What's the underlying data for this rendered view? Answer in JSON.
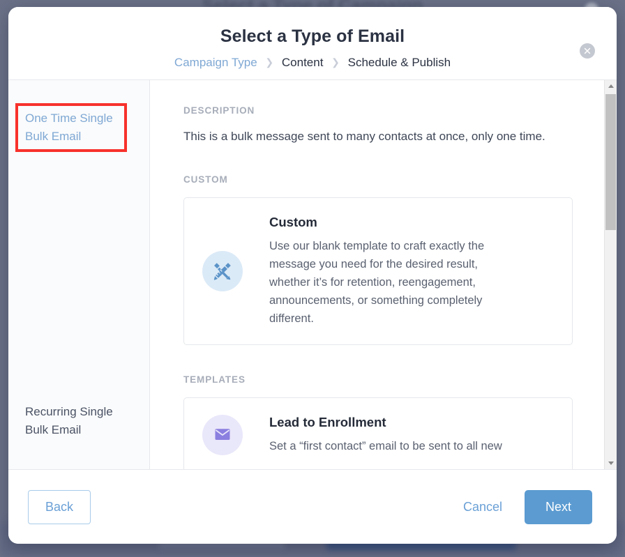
{
  "backdrop": {
    "blurred_title": "Select a Type of Campaign"
  },
  "modal": {
    "title": "Select a Type of Email",
    "close_icon": "close-icon",
    "breadcrumb": {
      "separator": "❯",
      "items": [
        {
          "label": "Campaign Type",
          "state": "link"
        },
        {
          "label": "Content",
          "state": "current"
        },
        {
          "label": "Schedule & Publish",
          "state": "current"
        }
      ]
    },
    "sidebar": {
      "items": [
        {
          "label": "One Time Single Bulk Email",
          "selected": true
        },
        {
          "label": "Recurring Single Bulk Email",
          "selected": false
        }
      ]
    },
    "content": {
      "description_label": "DESCRIPTION",
      "description_text": "This is a bulk message sent to many contacts at once, only one time.",
      "custom_label": "CUSTOM",
      "custom_card": {
        "title": "Custom",
        "text": "Use our blank template to craft exactly the message you need for the desired result, whether it’s for retention, reengagement, announcements, or something completely different.",
        "icon": "ruler-pencil-icon"
      },
      "templates_label": "TEMPLATES",
      "template_cards": [
        {
          "title": "Lead to Enrollment",
          "text": "Set a “first contact” email to be sent to all new",
          "icon": "template-icon"
        }
      ]
    },
    "scrollbar": {
      "up_arrow_icon": "caret-up-icon",
      "down_arrow_icon": "caret-down-icon"
    },
    "footer": {
      "back_label": "Back",
      "cancel_label": "Cancel",
      "next_label": "Next"
    }
  },
  "annotation": {
    "highlight_color": "#f8312c",
    "target": "One Time Single Bulk Email"
  },
  "colors": {
    "accent_blue": "#5b9bd1",
    "link_blue": "#7fa8d4",
    "text_dark": "#2b3242",
    "muted_label": "#a7adb9",
    "backdrop": "#6a7189",
    "icon_bubble": "#dbeaf7"
  }
}
